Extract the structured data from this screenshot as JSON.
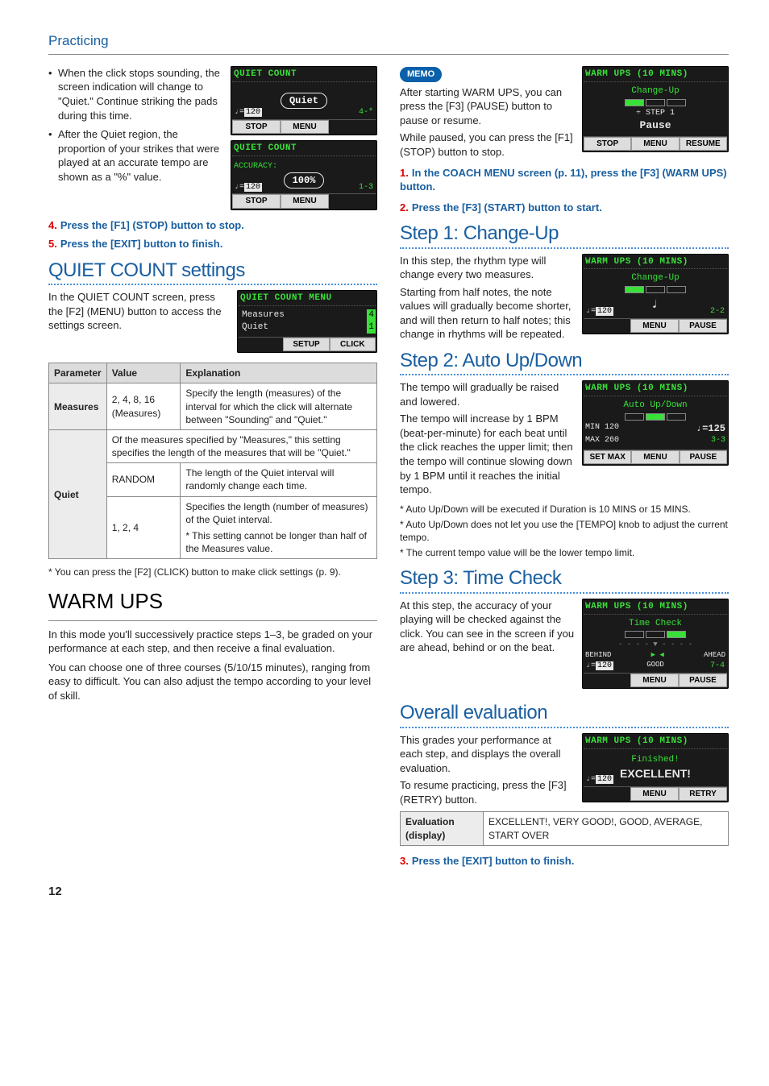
{
  "header": "Practicing",
  "pageNumber": "12",
  "left": {
    "bullets": [
      "When the click stops sounding, the screen indication will change to \"Quiet.\" Continue striking the pads during this time.",
      "After the Quiet region, the proportion of your strikes that were played at an accurate tempo are shown as a \"%\" value."
    ],
    "step4": {
      "num": "4.",
      "txt": "Press the [F1] (STOP) button to stop."
    },
    "step5": {
      "num": "5.",
      "txt": "Press the [EXIT] button to finish."
    },
    "qcSettingsTitle": "QUIET COUNT settings",
    "qcSettingsText": "In the QUIET COUNT screen, press the [F2] (MENU) button to access the settings screen.",
    "lcd_quiet": {
      "title": "QUIET COUNT",
      "center": "Quiet",
      "tempo": "120",
      "right": "4-*",
      "f": [
        "STOP",
        "MENU",
        ""
      ]
    },
    "lcd_acc": {
      "title": "QUIET COUNT",
      "label": "ACCURACY:",
      "center": "100%",
      "tempo": "120",
      "right": "1-3",
      "f": [
        "STOP",
        "MENU",
        ""
      ]
    },
    "lcd_menu": {
      "title": "QUIET COUNT MENU",
      "rows": [
        [
          "Measures",
          "4"
        ],
        [
          "Quiet",
          "1"
        ]
      ],
      "f": [
        "",
        "SETUP",
        "CLICK"
      ]
    },
    "table": {
      "head": [
        "Parameter",
        "Value",
        "Explanation"
      ],
      "measures": {
        "p": "Measures",
        "v": "2, 4, 8, 16 (Measures)",
        "e": "Specify the length (measures) of the interval for which the click will alternate between \"Sounding\" and \"Quiet.\""
      },
      "quiet_span": "Of the measures specified by \"Measures,\" this setting specifies the length of the measures that will be \"Quiet.\"",
      "quiet_random": {
        "v": "RANDOM",
        "e": "The length of the Quiet interval will randomly change each time."
      },
      "quiet_124": {
        "v": "1, 2, 4",
        "e": "Specifies the length (number of measures) of the Quiet interval.",
        "star": "This setting cannot be longer than half of the Measures value."
      },
      "quiet_label": "Quiet"
    },
    "footnote": "You can press the [F2] (CLICK) button to make click settings (p. 9).",
    "warmupsTitle": "WARM UPS",
    "warmupsP1": "In this mode you'll successively practice steps 1–3, be graded on your performance at each step, and then receive a final evaluation.",
    "warmupsP2": "You can choose one of three courses (5/10/15 minutes), ranging from easy to difficult. You can also adjust the tempo according to your level of skill."
  },
  "right": {
    "memoLabel": "MEMO",
    "memo1": "After starting WARM UPS, you can press the [F3] (PAUSE) button to pause or resume.",
    "memo2": "While paused, you can press the [F1] (STOP) button to stop.",
    "lcd_pause": {
      "title": "WARM UPS (10 MINS)",
      "l1": "Change-Up",
      "l2": "÷ STEP 1",
      "l3": "Pause",
      "f": [
        "STOP",
        "MENU",
        "RESUME"
      ]
    },
    "step1": {
      "num": "1.",
      "txt": "In the COACH MENU screen (p. 11), press the [F3] (WARM UPS) button."
    },
    "step2": {
      "num": "2.",
      "txt": "Press the [F3] (START) button to start."
    },
    "s1title": "Step 1: Change-Up",
    "s1p1": "In this step, the rhythm type will change every two measures.",
    "s1p2": "Starting from half notes, the note values will gradually become shorter, and will then return to half notes; this change in rhythms will be repeated.",
    "lcd_s1": {
      "title": "WARM UPS (10 MINS)",
      "l1": "Change-Up",
      "tempo": "120",
      "right": "2-2",
      "f": [
        "",
        "MENU",
        "PAUSE"
      ]
    },
    "s2title": "Step 2: Auto Up/Down",
    "s2p1": "The tempo will gradually be raised and lowered.",
    "s2p2": "The tempo will increase by 1 BPM (beat-per-minute) for each beat until the click reaches the upper limit; then the tempo will continue slowing down by 1 BPM until it reaches the initial tempo.",
    "s2stars": [
      "Auto Up/Down will be executed if Duration is 10 MINS or 15 MINS.",
      "Auto Up/Down does not let you use the [TEMPO] knob to adjust the current tempo.",
      "The current tempo value will be the lower tempo limit."
    ],
    "lcd_s2": {
      "title": "WARM UPS (10 MINS)",
      "l1": "Auto Up/Down",
      "min": "MIN 120",
      "max": "MAX 260",
      "tempo": "♩=125",
      "right": "3-3",
      "f": [
        "SET MAX",
        "MENU",
        "PAUSE"
      ]
    },
    "s3title": "Step 3: Time Check",
    "s3p": "At this step, the accuracy of your playing will be checked against the click. You can see in the screen if you are ahead, behind or on the beat.",
    "lcd_s3": {
      "title": "WARM UPS (10 MINS)",
      "l1": "Time Check",
      "behind": "BEHIND",
      "good": "GOOD",
      "ahead": "AHEAD",
      "tempo": "120",
      "right": "7-4",
      "f": [
        "",
        "MENU",
        "PAUSE"
      ]
    },
    "ovtitle": "Overall evaluation",
    "ovp1": "This grades your performance at each step, and displays the overall evaluation.",
    "ovp2": "To resume practicing, press the [F3] (RETRY) button.",
    "lcd_ov": {
      "title": "WARM UPS (10 MINS)",
      "l1": "Finished!",
      "l2": "EXCELLENT!",
      "tempo": "120",
      "f": [
        "",
        "MENU",
        "RETRY"
      ]
    },
    "evalLabel": "Evaluation (display)",
    "evalValue": "EXCELLENT!, VERY GOOD!, GOOD, AVERAGE, START OVER",
    "step3": {
      "num": "3.",
      "txt": "Press the [EXIT] button to finish."
    }
  }
}
